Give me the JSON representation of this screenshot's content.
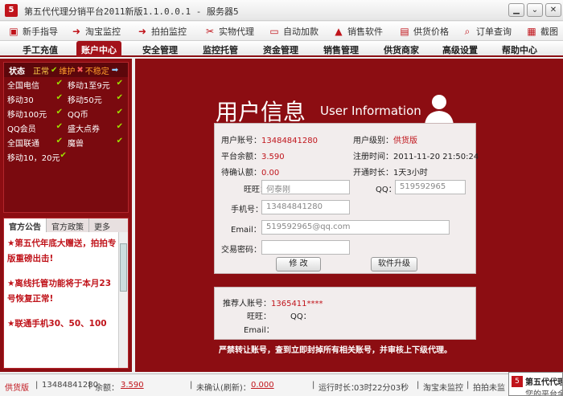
{
  "window": {
    "title": "第五代代理分销平台2011新版1.1.0.0.1 - 服务器5",
    "minimize": "▁",
    "restore": "⌄",
    "close": "✕"
  },
  "toolbar": [
    {
      "label": "新手指导",
      "icon": "guide-icon",
      "glyph": "▣"
    },
    {
      "label": "淘宝监控",
      "icon": "taobao-monitor-icon",
      "glyph": "➜"
    },
    {
      "label": "拍拍监控",
      "icon": "paipai-monitor-icon",
      "glyph": "➜"
    },
    {
      "label": "实物代理",
      "icon": "goods-proxy-icon",
      "glyph": "✂"
    },
    {
      "label": "自动加款",
      "icon": "auto-deposit-icon",
      "glyph": "▭"
    },
    {
      "label": "销售软件",
      "icon": "sell-software-icon",
      "glyph": "▲"
    },
    {
      "label": "供货价格",
      "icon": "supply-price-icon",
      "glyph": "▤"
    },
    {
      "label": "订单查询",
      "icon": "order-search-icon",
      "glyph": "⌕"
    },
    {
      "label": "截图",
      "icon": "screenshot-icon",
      "glyph": "▦"
    }
  ],
  "nav": [
    "手工充值",
    "账户中心",
    "安全管理",
    "监控托管",
    "资金管理",
    "销售管理",
    "供货商家",
    "高级设置",
    "帮助中心"
  ],
  "status": {
    "title": "状态",
    "normal": "正常",
    "maintain": "维护",
    "unstable": "不稳定",
    "check": "✔",
    "cross": "✖",
    "arrow": "➡",
    "items": [
      {
        "name": "全国电信",
        "mark": "✔"
      },
      {
        "name": "移动1至9元",
        "mark": "✔"
      },
      {
        "name": "移动30",
        "mark": "✔"
      },
      {
        "name": "移动50元",
        "mark": "✔"
      },
      {
        "name": "移动100元",
        "mark": "✔"
      },
      {
        "name": "QQ币",
        "mark": "✔"
      },
      {
        "name": "QQ会员",
        "mark": "✔"
      },
      {
        "name": "盛大点券",
        "mark": "✔"
      },
      {
        "name": "全国联通",
        "mark": "✔"
      },
      {
        "name": "魔兽",
        "mark": "✔"
      },
      {
        "name": "移动10，20元",
        "mark": "✔"
      }
    ]
  },
  "notice": {
    "tabs": [
      "官方公告",
      "官方政策",
      "更多"
    ],
    "lines": [
      "★第五代年底大赠送，拍拍专版重磅出击!",
      "★离线托管功能将于本月23号恢复正常!",
      "★联通手机30、50、100"
    ]
  },
  "user_info": {
    "title": "用户信息",
    "subtitle": "User Information",
    "account_label": "用户账号：",
    "account": "13484841280",
    "level_label": "用户级别：",
    "level": "供货版",
    "balance_label": "平台余额：",
    "balance": "3.590",
    "register_label": "注册时间：",
    "register": "2011-11-20 21:50:24",
    "pending_label": "待确认额：",
    "pending": "0.00",
    "duration_label": "开通时长：",
    "duration": "1天3小时",
    "wangwang_label": "旺旺：",
    "wangwang": "何泰刚",
    "qq_label": "QQ：",
    "qq": "519592965",
    "mobile_label": "手机号：",
    "mobile": "13484841280",
    "email_label": "Email：",
    "email": "519592965@qq.com",
    "trade_pwd_label": "交易密码：",
    "trade_pwd": "",
    "modify_btn": "修  改",
    "upgrade_btn": "软件升级"
  },
  "referrer": {
    "account_label": "推荐人账号：",
    "account": "1365411****",
    "wangwang_label": "旺旺：",
    "qq_label": "QQ：",
    "email_label": "Email："
  },
  "warning": "严禁转让账号，查到立即封掉所有相关账号，并审核上下级代理。",
  "statusbar": {
    "version": "供货版",
    "account": "13484841280",
    "balance_label": "余额：",
    "balance": "3.590",
    "pending_label": "未确认(刷新)：",
    "pending": "0.000",
    "runtime_label": "运行时长：",
    "runtime": "03时22分03秒",
    "taobao": "淘宝未监控",
    "paipai": "拍拍未监"
  },
  "popup": {
    "title": "第五代代理",
    "text": "您的平台余额不"
  }
}
